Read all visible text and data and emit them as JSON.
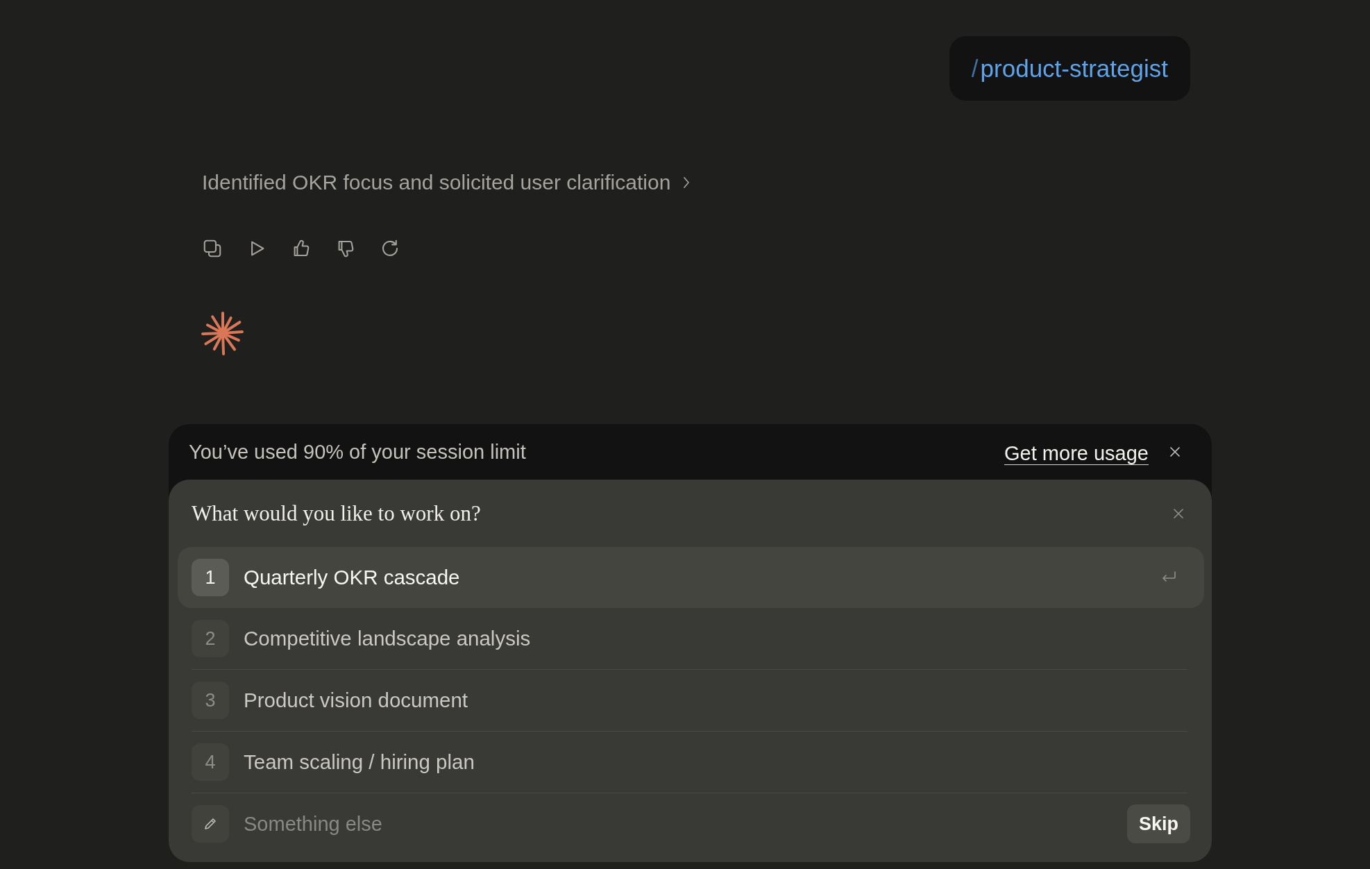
{
  "user_message": {
    "prefix": "/",
    "command": "product-strategist"
  },
  "thinking_summary": {
    "text": "Identified OKR focus and solicited user clarification"
  },
  "usage_banner": {
    "text": "You’ve used 90% of your session limit",
    "link": "Get more usage"
  },
  "question": {
    "title": "What would you like to work on?",
    "options": [
      {
        "number": "1",
        "label": "Quarterly OKR cascade",
        "selected": true
      },
      {
        "number": "2",
        "label": "Competitive landscape analysis",
        "selected": false
      },
      {
        "number": "3",
        "label": "Product vision document",
        "selected": false
      },
      {
        "number": "4",
        "label": "Team scaling / hiring plan",
        "selected": false
      }
    ],
    "other": {
      "placeholder": "Something else"
    },
    "skip_button": "Skip"
  }
}
